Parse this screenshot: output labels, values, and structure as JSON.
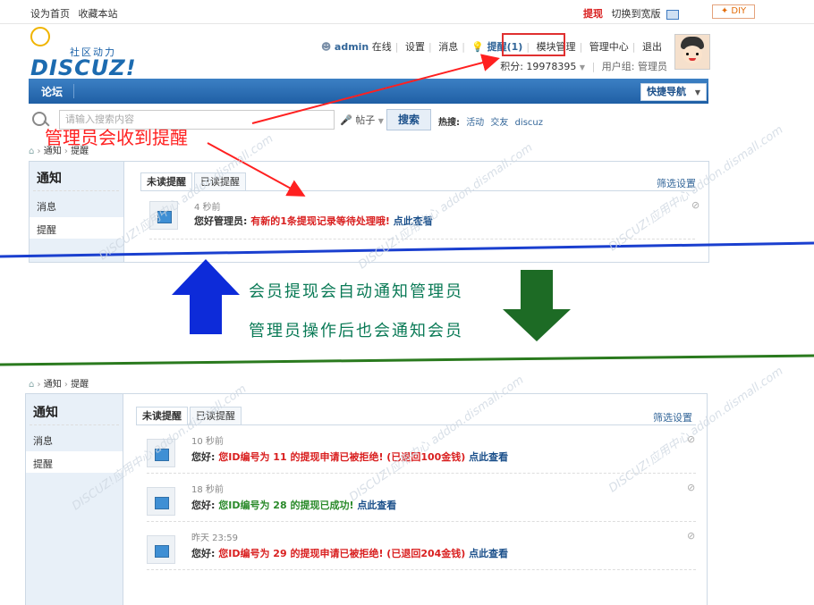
{
  "topbar": {
    "set_home": "设为首页",
    "bookmark": "收藏本站",
    "withdraw": "提现",
    "switch_wide": "切换到宽版",
    "diy": "✦ DIY"
  },
  "header": {
    "logo_main": "DISCUZ!",
    "logo_sub": "社区动力",
    "user": "admin",
    "online": "在线",
    "settings": "设置",
    "messages": "消息",
    "remind": "提醒(1)",
    "module_manage": "模块管理",
    "admin_center": "管理中心",
    "logout": "退出",
    "credits": "积分: 19978395",
    "user_group": "用户组: 管理员"
  },
  "nav": {
    "forum": "论坛",
    "quick_nav": "快捷导航"
  },
  "search": {
    "placeholder": "请输入搜索内容",
    "type": "帖子",
    "button": "搜索",
    "hot_label": "热搜:",
    "hot_items": [
      "活动",
      "交友",
      "discuz"
    ]
  },
  "breadcrumb": {
    "sep": "›",
    "notice": "通知",
    "remind": "提醒"
  },
  "sidebar": {
    "title": "通知",
    "items": [
      "消息",
      "提醒"
    ]
  },
  "tabs": {
    "unread": "未读提醒",
    "read": "已读提醒",
    "filter": "筛选设置"
  },
  "top_notice": {
    "time": "4 秒前",
    "greeting": "您好管理员:",
    "text": "有新的1条提现记录等待处理哦!",
    "link": "点此查看"
  },
  "bottom_notices": [
    {
      "time": "10 秒前",
      "greeting": "您好:",
      "text": "您ID编号为 11 的提现申请已被拒绝! (已退回100金钱)",
      "link": "点此查看",
      "status": "red"
    },
    {
      "time": "18 秒前",
      "greeting": "您好:",
      "text": "您ID编号为 28 的提现已成功!",
      "link": "点此查看",
      "status": "green"
    },
    {
      "time": "昨天 23:59",
      "greeting": "您好:",
      "text": "您ID编号为 29 的提现申请已被拒绝! (已退回204金钱)",
      "link": "点此查看",
      "status": "red"
    }
  ],
  "annotations": {
    "admin_receive": "管理员会收到提醒",
    "member_notify": "会员提现会自动通知管理员",
    "admin_notify": "管理员操作后也会通知会员"
  },
  "colors": {
    "nav_blue": "#2b6fb6",
    "annot_red": "#ff2020",
    "arrow_blue": "#0d2bd9",
    "arrow_green": "#1d6b25",
    "line_blue": "#1a3fcf",
    "line_green": "#2a7a1e"
  },
  "watermark": "DISCUZ!应用中心 addon.dismall.com"
}
